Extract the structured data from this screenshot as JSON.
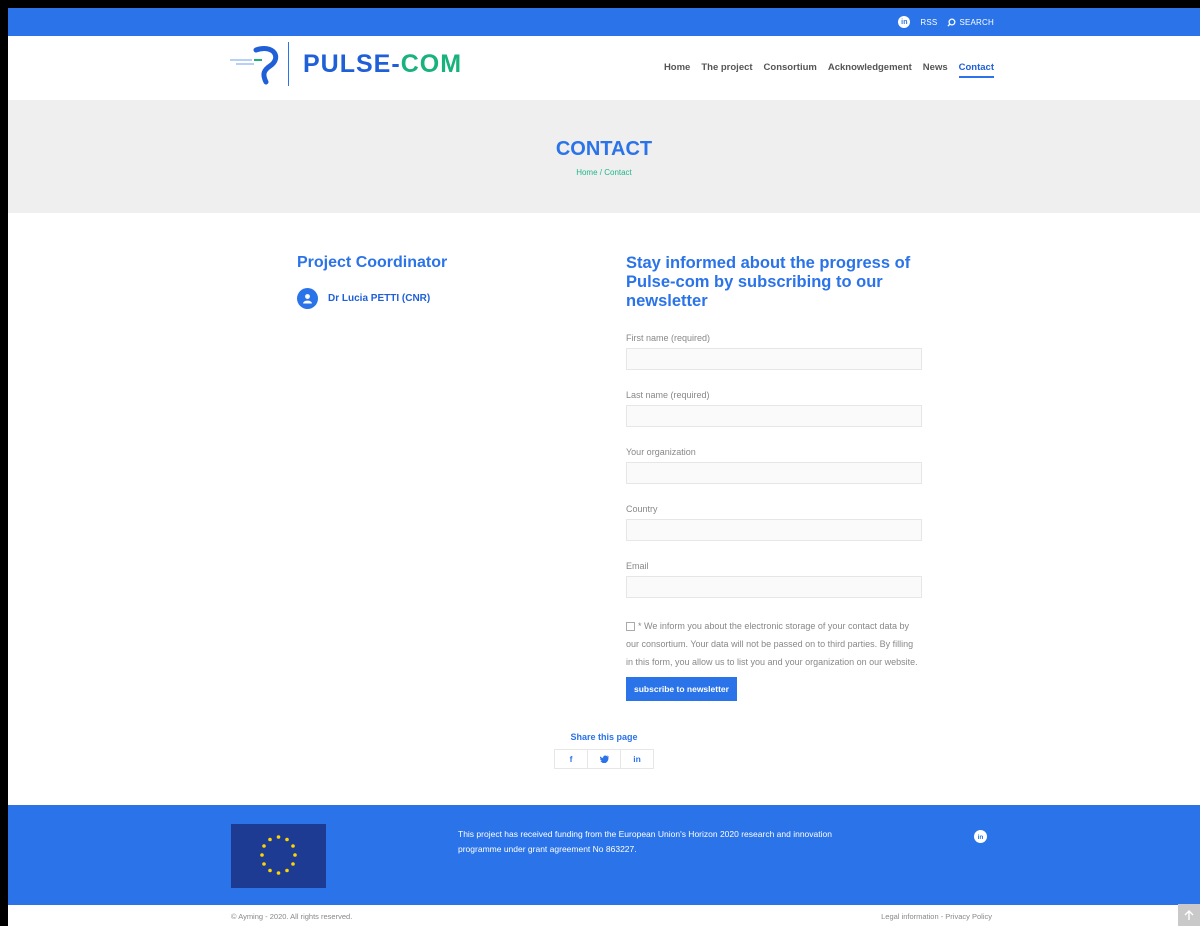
{
  "topbar": {
    "rss": "RSS",
    "search": "SEARCH",
    "linkedin_icon": "linkedin-icon"
  },
  "logo": {
    "word_main": "PULSE-",
    "word_end": "COM"
  },
  "nav": [
    "Home",
    "The project",
    "Consortium",
    "Acknowledgement",
    "News",
    "Contact"
  ],
  "nav_active": "Contact",
  "hero": {
    "title": "CONTACT",
    "crumb": "Home / Contact"
  },
  "coordinator": {
    "heading": "Project Coordinator",
    "name": "Dr Lucia PETTI (CNR)"
  },
  "newsletter": {
    "heading": "Stay informed about the progress of Pulse-com by subscribing to our newsletter",
    "fields": [
      {
        "label": "First name (required)",
        "value": ""
      },
      {
        "label": "Last name (required)",
        "value": ""
      },
      {
        "label": "Your organization",
        "value": ""
      },
      {
        "label": "Country",
        "value": ""
      },
      {
        "label": "Email",
        "value": ""
      }
    ],
    "consent": "* We inform you about the electronic storage of your contact data by our consortium. Your data will not be passed on to third parties. By filling in this form, you allow us to list you and your organization on our website.",
    "button": "subscribe to newsletter"
  },
  "share": {
    "title": "Share this page",
    "facebook": "f",
    "twitter": "🐦",
    "linkedin": "in"
  },
  "footer": {
    "funding": "This project has received funding from the European Union's Horizon 2020 research and innovation programme under grant agreement No 863227.",
    "copyright": "© Ayming - 2020. All rights reserved.",
    "legal": "Legal information - Privacy Policy"
  },
  "colors": {
    "brand_blue": "#2a73e8",
    "brand_green": "#18b27c"
  }
}
